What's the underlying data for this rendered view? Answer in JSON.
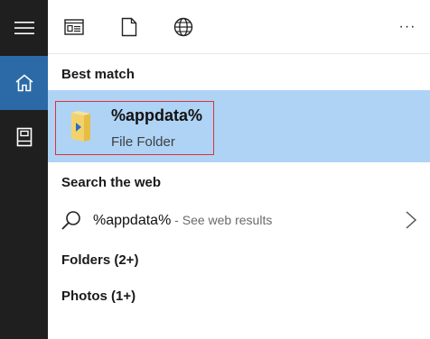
{
  "rail": {
    "items": [
      {
        "name": "menu",
        "icon": "hamburger-icon"
      },
      {
        "name": "home",
        "icon": "home-icon",
        "active": true
      },
      {
        "name": "notebook",
        "icon": "notebook-icon"
      }
    ],
    "accent": "#2b6aa6",
    "background": "#1f1f1f"
  },
  "toolbar": {
    "filters": [
      {
        "name": "apps",
        "icon": "apps-filter-icon"
      },
      {
        "name": "documents",
        "icon": "document-icon"
      },
      {
        "name": "web",
        "icon": "globe-icon"
      }
    ],
    "more_icon": "ellipsis-icon",
    "more_glyph": "···"
  },
  "sections": {
    "best_match": "Best match",
    "search_web": "Search the web"
  },
  "best_match": {
    "title": "%appdata%",
    "subtitle": "File Folder",
    "icon": "folder-icon",
    "highlight_color": "#aed3f5",
    "outline_color": "#e0303a"
  },
  "web_result": {
    "query": "%appdata%",
    "hint": " - See web results",
    "icon": "search-icon",
    "chevron_icon": "chevron-right-icon"
  },
  "categories": {
    "folders": "Folders (2+)",
    "photos": "Photos (1+)"
  }
}
